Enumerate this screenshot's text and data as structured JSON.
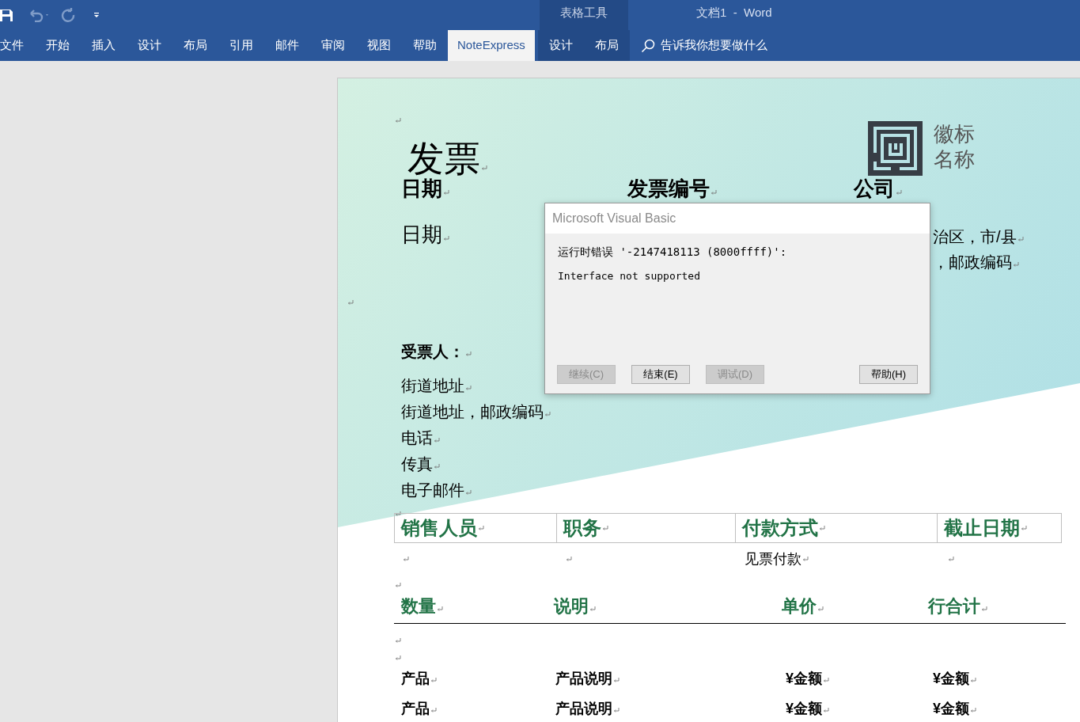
{
  "title_bar": {
    "context_group": "表格工具",
    "document_title": "文档1  -  Word"
  },
  "ribbon_tabs": [
    {
      "label": "文件",
      "selected": false,
      "contextual": false
    },
    {
      "label": "开始",
      "selected": false,
      "contextual": false
    },
    {
      "label": "插入",
      "selected": false,
      "contextual": false
    },
    {
      "label": "设计",
      "selected": false,
      "contextual": false
    },
    {
      "label": "布局",
      "selected": false,
      "contextual": false
    },
    {
      "label": "引用",
      "selected": false,
      "contextual": false
    },
    {
      "label": "邮件",
      "selected": false,
      "contextual": false
    },
    {
      "label": "审阅",
      "selected": false,
      "contextual": false
    },
    {
      "label": "视图",
      "selected": false,
      "contextual": false
    },
    {
      "label": "帮助",
      "selected": false,
      "contextual": false
    },
    {
      "label": "NoteExpress",
      "selected": true,
      "contextual": false
    },
    {
      "label": "设计",
      "selected": false,
      "contextual": true
    },
    {
      "label": "布局",
      "selected": false,
      "contextual": true
    }
  ],
  "tell_me": "告诉我你想要做什么",
  "document": {
    "show_formatting_marks": true,
    "title": "发票",
    "logo_text": [
      "徽标",
      "名称"
    ],
    "header_columns": [
      {
        "heading": "日期",
        "lines": [
          "日期"
        ]
      },
      {
        "heading": "发票编号"
      },
      {
        "heading": "公司",
        "lines": [
          "治区，市/县",
          "，邮政编码"
        ]
      }
    ],
    "bill_to": {
      "heading": "受票人：",
      "lines": [
        "街道地址",
        "街道地址，邮政编码",
        "电话",
        "传真",
        "电子邮件"
      ]
    },
    "sales_table": {
      "columns": [
        "销售人员",
        "职务",
        "付款方式",
        "截止日期"
      ],
      "row": {
        "column_3": "见票付款"
      }
    },
    "items_table": {
      "columns": [
        "数量",
        "说明",
        "单价",
        "行合计"
      ],
      "rows": [
        [
          "产品",
          "产品说明",
          "¥金额",
          "¥金额"
        ],
        [
          "产品",
          "产品说明",
          "¥金额",
          "¥金额"
        ]
      ]
    }
  },
  "dialog": {
    "title": "Microsoft Visual Basic",
    "message": "运行时错误 '-2147418113 (8000ffff)':",
    "detail": "Interface not supported",
    "buttons": [
      {
        "label": "继续(C)",
        "disabled": true
      },
      {
        "label": "结束(E)",
        "disabled": false
      },
      {
        "label": "调试(D)",
        "disabled": true
      },
      {
        "label": "帮助(H)",
        "disabled": false
      }
    ]
  }
}
